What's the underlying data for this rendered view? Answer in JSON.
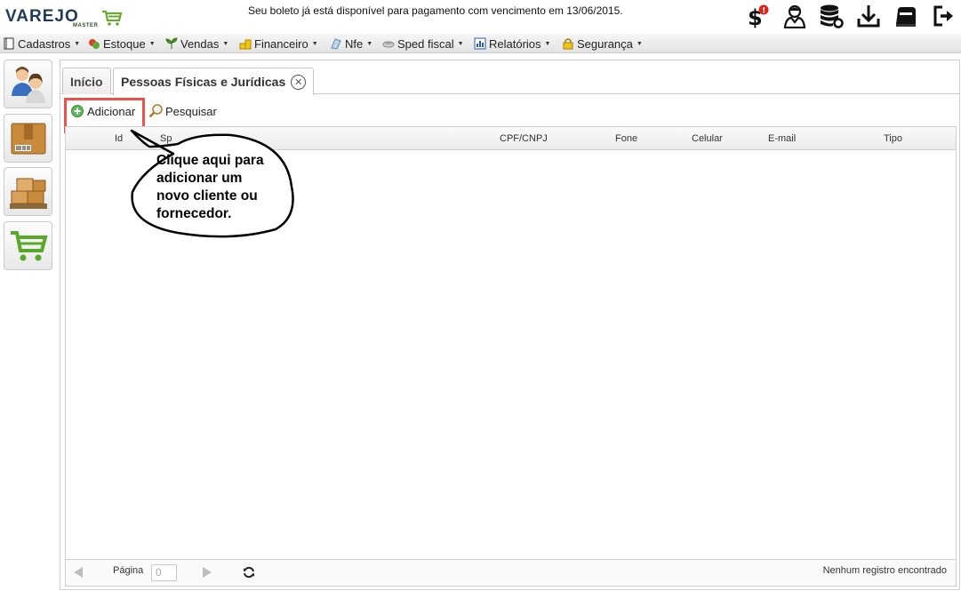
{
  "header": {
    "logo_text": "VAREJO",
    "logo_sub": "MASTER",
    "notice": "Seu boleto já está disponível para pagamento com vencimento em 13/06/2015.",
    "icons": [
      "dollar-alert-icon",
      "user-support-icon",
      "database-settings-icon",
      "download-icon",
      "printer-icon",
      "logout-icon"
    ],
    "badge": "!"
  },
  "menu": [
    {
      "label": "Cadastros",
      "icon": "notebook-icon"
    },
    {
      "label": "Estoque",
      "icon": "boxes-icon"
    },
    {
      "label": "Vendas",
      "icon": "plant-icon"
    },
    {
      "label": "Financeiro",
      "icon": "coins-icon"
    },
    {
      "label": "Nfe",
      "icon": "document-icon"
    },
    {
      "label": "Sped fiscal",
      "icon": "disk-icon"
    },
    {
      "label": "Relatórios",
      "icon": "report-icon"
    },
    {
      "label": "Segurança",
      "icon": "lock-icon"
    }
  ],
  "sidebar": [
    "people-icon",
    "barcode-box-icon",
    "pallet-boxes-icon",
    "shopping-cart-icon"
  ],
  "tabs": [
    {
      "label": "Início"
    },
    {
      "label": "Pessoas Físicas e Jurídicas"
    }
  ],
  "toolbar": {
    "add_label": "Adicionar",
    "search_label": "Pesquisar"
  },
  "grid": {
    "columns": [
      "Id",
      "Sp",
      "CPF/CNPJ",
      "Fone",
      "Celular",
      "E-mail",
      "Tipo"
    ]
  },
  "footer": {
    "page_label": "Página",
    "page_value": "0",
    "status": "Nenhum registro encontrado"
  },
  "callout": {
    "line1": "Clique aqui para",
    "line2": "adicionar um",
    "line3": "novo cliente ou",
    "line4": "fornecedor."
  },
  "colors": {
    "highlight": "#e8534a",
    "brand_dark": "#1f3a5a",
    "brand_green": "#6aa832"
  }
}
